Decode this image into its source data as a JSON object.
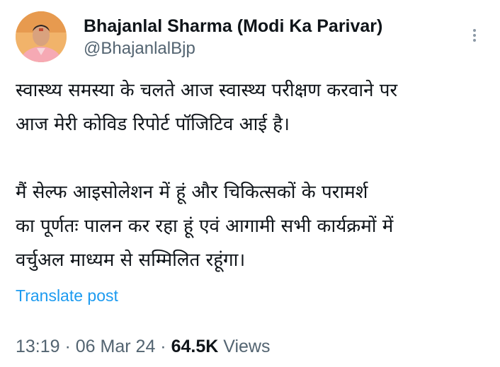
{
  "author": {
    "display_name": "Bhajanlal Sharma (Modi Ka Parivar)",
    "handle": "@BhajanlalBjp"
  },
  "post": {
    "paragraphs": [
      "स्वास्थ्य समस्या के चलते आज स्वास्थ्य परीक्षण करवाने पर\nआज मेरी कोविड रिपोर्ट पॉजिटिव आई है।",
      "मैं सेल्फ आइसोलेशन में हूं और चिकित्सकों के परामर्श\nका पूर्णतः पालन कर रहा हूं एवं आगामी सभी कार्यक्रमों में\nवर्चुअल माध्यम से सम्मिलित रहूंगा।"
    ],
    "translate_label": "Translate post"
  },
  "meta": {
    "time": "13:19",
    "date": "06 Mar 24",
    "separator": " · ",
    "views_count": "64.5K",
    "views_label": "Views"
  },
  "icons": {
    "more": "more-vertical-icon",
    "avatar": "profile-photo"
  },
  "colors": {
    "link": "#1d9bf0",
    "secondary_text": "#536471",
    "primary_text": "#0f1419"
  }
}
